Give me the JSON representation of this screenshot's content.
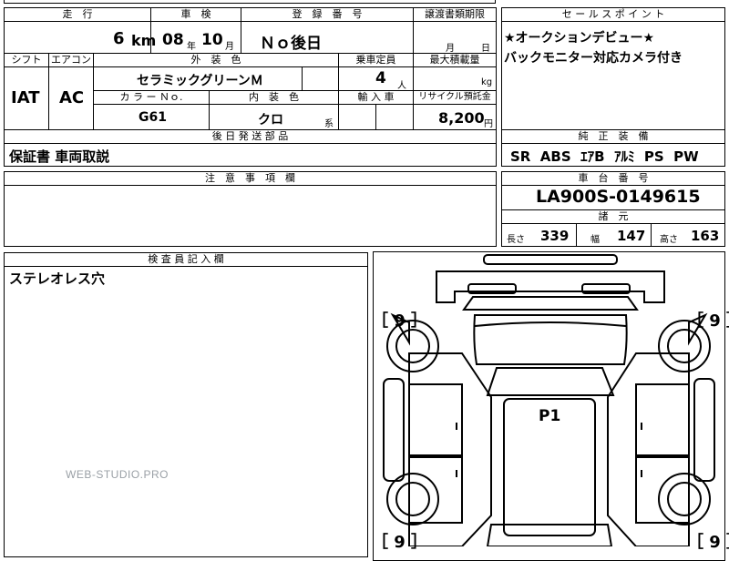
{
  "top": {
    "mileage_header": "走　行",
    "mileage_value": "6",
    "mileage_unit": "km",
    "inspection_header": "車　検",
    "inspection_year": "08",
    "inspection_year_unit": "年",
    "inspection_month": "10",
    "inspection_month_unit": "月",
    "registration_header": "登　録　番　号",
    "registration_value": "Ｎｏ後日",
    "transfer_header": "譲渡書類期限",
    "transfer_month_unit": "月",
    "transfer_day_unit": "日"
  },
  "row2": {
    "shift_header": "シフト",
    "shift_value": "IAT",
    "ac_header": "エアコン",
    "ac_value": "AC",
    "exterior_color_header": "外　装　色",
    "exterior_color_value": "セラミックグリーンＭ",
    "capacity_header": "乗車定員",
    "capacity_value": "4",
    "capacity_unit": "人",
    "max_load_header": "最大積載量",
    "max_load_unit": "kg",
    "color_no_header": "カ ラ ー Ｎｏ.",
    "color_no_value": "G61",
    "interior_color_header": "内　装　色",
    "interior_color_value": "クロ",
    "interior_color_suffix": "系",
    "import_header": "輸 入 車",
    "recycle_header": "リサイクル預託金",
    "recycle_value": "8,200",
    "recycle_unit": "円"
  },
  "later_parts": {
    "header": "後 日 発 送 部 品",
    "value": "保証書 車両取説"
  },
  "notes": {
    "header": "注　意　事　項　欄"
  },
  "inspector": {
    "header": "検 査 員 記 入 欄",
    "value": "ステレオレス穴"
  },
  "sales_point": {
    "header": "セ ー ル ス ポ イ ン ト",
    "line1": "★オークションデビュー★",
    "line2": "バックモニター対応カメラ付き"
  },
  "equipment": {
    "header": "純　正　装　備",
    "value": "SR  ABS  ｴｱB  ｱﾙﾐ  PS  PW"
  },
  "chassis": {
    "header": "車　台　番　号",
    "value": "LA900S-0149615"
  },
  "specs": {
    "header": "諸　元",
    "length_label": "長さ",
    "length_value": "339",
    "width_label": "幅",
    "width_value": "147",
    "height_label": "高さ",
    "height_value": "163"
  },
  "diagram": {
    "tire_tl": "［ 9 ］",
    "tire_tr": "［ 9 ］",
    "tire_bl": "［ 9 ］",
    "tire_br": "［ 9 ］",
    "center_mark": "P1",
    "watermark": "WEB-STUDIO.PRO"
  }
}
